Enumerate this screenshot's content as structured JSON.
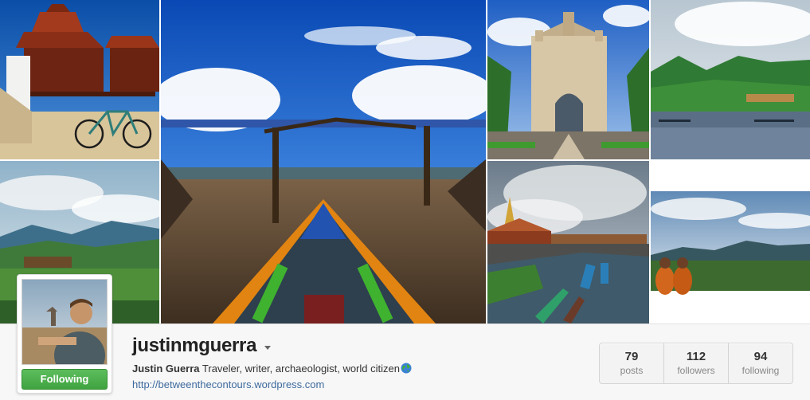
{
  "profile": {
    "username": "justinmguerra",
    "full_name": "Justin Guerra",
    "bio": " Traveler, writer, archaeologist, world citizen",
    "website": "http://betweenthecontours.wordpress.com",
    "follow_button_label": "Following",
    "follow_button_color": "#4cae4c"
  },
  "stats": [
    {
      "count": "79",
      "label": "posts"
    },
    {
      "count": "112",
      "label": "followers"
    },
    {
      "count": "94",
      "label": "following"
    }
  ],
  "mosaic": {
    "photos": [
      {
        "subject": "burmese-monastery-with-bicycle"
      },
      {
        "subject": "green-valley-landscape"
      },
      {
        "subject": "longtail-boat-canal"
      },
      {
        "subject": "patuxai-monument"
      },
      {
        "subject": "pagoda-lakeside-boats"
      },
      {
        "subject": "mountain-lake"
      },
      {
        "subject": "monks-overlooking-valley"
      }
    ]
  },
  "icons": {
    "globe": "globe-emoji-icon",
    "dropdown": "caret-down-icon"
  }
}
